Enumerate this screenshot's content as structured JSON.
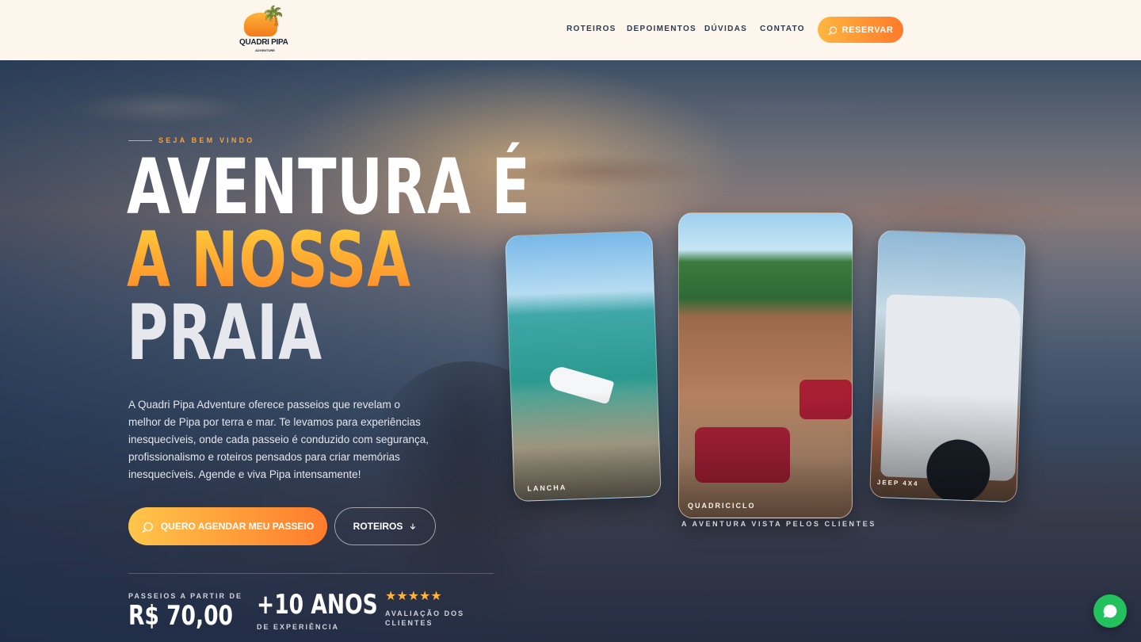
{
  "header": {
    "logo_text": "QUADRI PIPA",
    "logo_subtext": "ADVENTURE",
    "nav": [
      "ROTEIROS",
      "DEPOIMENTOS",
      "DÚVIDAS",
      "CONTATO"
    ],
    "cta_label": "RESERVAR"
  },
  "hero": {
    "eyebrow": "SEJA BEM VINDO",
    "headline_line1": "AVENTURA É",
    "headline_line2": "A NOSSA",
    "headline_line3": "PRAIA",
    "description": "A Quadri Pipa Adventure oferece passeios que revelam o melhor de Pipa por terra e mar. Te levamos para experiências inesquecíveis, onde cada passeio é conduzido com segurança, profissionalismo e roteiros pensados para criar memórias inesquecíveis. Agende e viva Pipa intensamente!",
    "primary_cta": "QUERO AGENDAR MEU PASSEIO",
    "secondary_cta": "ROTEIROS"
  },
  "stats": {
    "price_label": "PASSEIOS A PARTIR DE",
    "price_value": "R$ 70,00",
    "years_value": "+10 ANOS",
    "years_label": "DE EXPERIÊNCIA",
    "rating_stars": "★★★★★",
    "rating_label": "AVALIAÇÃO DOS CLIENTES"
  },
  "cards": {
    "items": [
      {
        "title": "LANCHA"
      },
      {
        "title": "QUADRICICLO"
      },
      {
        "title": "JEEP 4X4"
      }
    ],
    "caption": "A AVENTURA VISTA PELOS CLIENTES"
  },
  "colors": {
    "accent_orange": "#ff7a2a",
    "accent_yellow": "#ffc64a",
    "header_bg": "#fdf6ec",
    "whatsapp_green": "#22c15e"
  },
  "icons": {
    "reserve": "chat-bubble-icon",
    "agendar": "chat-bubble-icon",
    "roteiros": "arrow-down-icon",
    "fab": "whatsapp-chat-icon"
  }
}
